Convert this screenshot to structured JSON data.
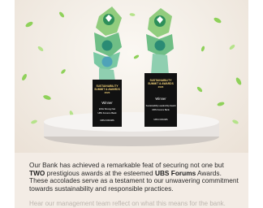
{
  "left_trophy": {
    "heading_line1": "SUSTAINABILITY",
    "heading_line2": "SUMMIT & AWARDS",
    "heading_line3": "2023",
    "award": "Winner",
    "line1": "ESG Strong Net",
    "line2": "UBS Forums Bank",
    "logo": "UBS FORUMS"
  },
  "right_trophy": {
    "heading_line1": "SUSTAINABILITY",
    "heading_line2": "SUMMIT & AWARDS",
    "heading_line3": "2023",
    "award": "Winner",
    "line1": "Sustainability Leadership Award",
    "line2": "UBS Forums Bank",
    "logo": "UBS FORUMS"
  },
  "body": {
    "p1_part1": "Our Bank has achieved a remarkable feat of securing not one but ",
    "p1_bold1": "TWO",
    "p1_part2": " prestigious awards at the esteemed ",
    "p1_bold2": "UBS Forums",
    "p1_part3": " Awards. These accolades serve as a testament to our unwavering commitment towards sustainability and responsible practices.",
    "faded_line": "Hear our management team reflect on what this means for the bank."
  },
  "colors": {
    "card_bg": "#f3ece5",
    "leaf_green": "#8fd15a",
    "trophy_base": "#111111",
    "trophy_gold": "#f1d27a",
    "pedestal": "#e8e4e1"
  }
}
